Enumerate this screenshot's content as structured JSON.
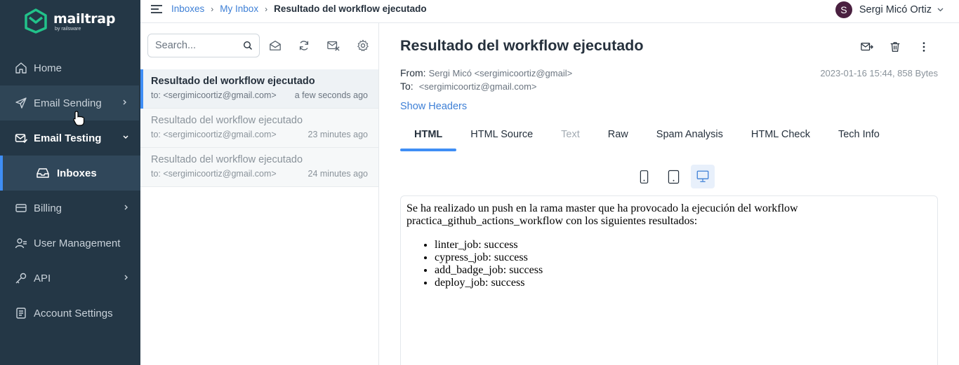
{
  "app": {
    "logo_text": "mailtrap",
    "logo_sub": "by railsware"
  },
  "sidebar": {
    "items": [
      {
        "label": "Home",
        "icon": "home-icon"
      },
      {
        "label": "Email Sending",
        "icon": "send-icon"
      },
      {
        "label": "Email Testing",
        "icon": "email-testing-icon"
      },
      {
        "label": "Inboxes",
        "icon": "inbox-icon"
      },
      {
        "label": "Billing",
        "icon": "billing-icon"
      },
      {
        "label": "User Management",
        "icon": "user-management-icon"
      },
      {
        "label": "API",
        "icon": "key-icon"
      },
      {
        "label": "Account Settings",
        "icon": "document-icon"
      }
    ]
  },
  "breadcrumb": {
    "items": [
      "Inboxes",
      "My Inbox"
    ],
    "current": "Resultado del workflow ejecutado",
    "separator": "›"
  },
  "user": {
    "initial": "S",
    "name": "Sergi Micó Ortiz"
  },
  "search": {
    "placeholder": "Search..."
  },
  "messages": [
    {
      "subject": "Resultado del workflow ejecutado",
      "to": "to: <sergimicoortiz@gmail.com>",
      "time": "a few seconds ago"
    },
    {
      "subject": "Resultado del workflow ejecutado",
      "to": "to: <sergimicoortiz@gmail.com>",
      "time": "23 minutes ago"
    },
    {
      "subject": "Resultado del workflow ejecutado",
      "to": "to: <sergimicoortiz@gmail.com>",
      "time": "24 minutes ago"
    }
  ],
  "view": {
    "title": "Resultado del workflow ejecutado",
    "from_label": "From:",
    "from_value": "Sergi Micó <sergimicoortiz@gmail>",
    "to_label": "To:",
    "to_value": "<sergimicoortiz@gmail.com>",
    "meta": "2023-01-16 15:44, 858 Bytes",
    "show_headers": "Show Headers",
    "tabs": [
      "HTML",
      "HTML Source",
      "Text",
      "Raw",
      "Spam Analysis",
      "HTML Check",
      "Tech Info"
    ]
  },
  "body": {
    "line1": "Se ha realizado un push en la rama master que ha provocado la ejecución del workflow",
    "line2": "practica_github_actions_workflow con los siguientes resultados:",
    "items": [
      "linter_job: success",
      "cypress_job: success",
      "add_badge_job: success",
      "deploy_job: success"
    ]
  },
  "colors": {
    "sidebar_bg": "#243746",
    "accent": "#3f8ef5",
    "link": "#3d7fd6",
    "logo_green": "#22c28a"
  }
}
